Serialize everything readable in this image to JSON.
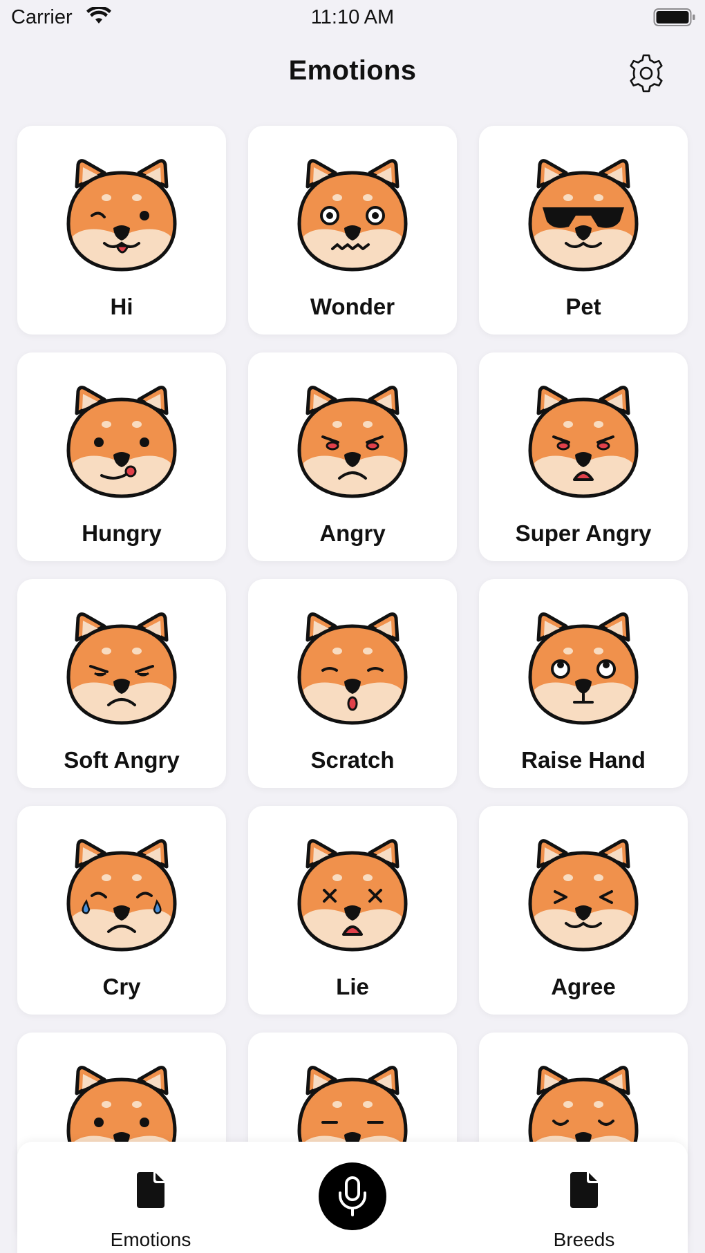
{
  "status_bar": {
    "carrier": "Carrier",
    "time": "11:10 AM"
  },
  "header": {
    "title": "Emotions",
    "settings_icon": "gear-icon"
  },
  "emotions": [
    {
      "label": "Hi",
      "expression": "wink-tongue"
    },
    {
      "label": "Wonder",
      "expression": "wonder"
    },
    {
      "label": "Pet",
      "expression": "sunglasses"
    },
    {
      "label": "Hungry",
      "expression": "hungry"
    },
    {
      "label": "Angry",
      "expression": "angry"
    },
    {
      "label": "Super Angry",
      "expression": "super-angry"
    },
    {
      "label": "Soft Angry",
      "expression": "soft-angry"
    },
    {
      "label": "Scratch",
      "expression": "scratch"
    },
    {
      "label": "Raise Hand",
      "expression": "raise-hand"
    },
    {
      "label": "Cry",
      "expression": "cry"
    },
    {
      "label": "Lie",
      "expression": "lie"
    },
    {
      "label": "Agree",
      "expression": "agree"
    },
    {
      "label": "",
      "expression": "partial-dots"
    },
    {
      "label": "",
      "expression": "partial-flat"
    },
    {
      "label": "",
      "expression": "partial-closed"
    }
  ],
  "tab_bar": {
    "left_tab": {
      "label": "Emotions",
      "icon": "document-icon"
    },
    "center_button": {
      "icon": "microphone-icon"
    },
    "right_tab": {
      "label": "Breeds",
      "icon": "document-icon"
    }
  },
  "colors": {
    "background": "#f2f1f6",
    "dog_orange": "#f0914c",
    "dog_cream": "#f8dcc1",
    "ear_inner": "#f6dcc4",
    "outline": "#111111",
    "tongue_red": "#e0404a"
  }
}
